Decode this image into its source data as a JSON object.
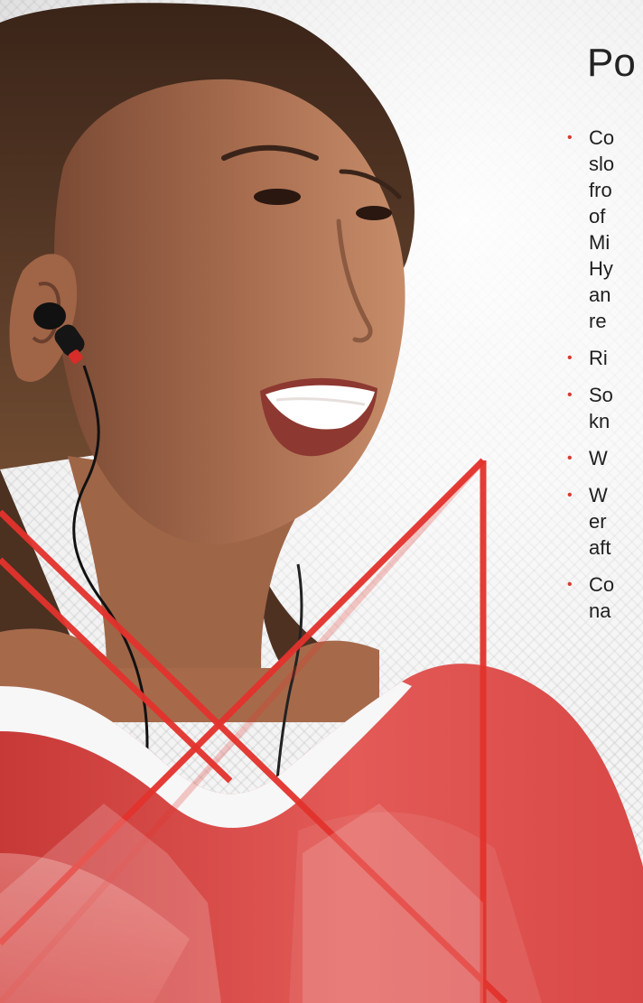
{
  "slide": {
    "title": "Po",
    "bullets": [
      {
        "lines": [
          "Co",
          "slo",
          "fro",
          "of",
          "Mi",
          "Hy",
          "an",
          "re"
        ]
      },
      {
        "lines": [
          "Ri"
        ]
      },
      {
        "lines": [
          "So",
          "kn"
        ]
      },
      {
        "lines": [
          "W"
        ]
      },
      {
        "lines": [
          "W",
          "er",
          "aft"
        ]
      },
      {
        "lines": [
          "Co",
          "na"
        ]
      }
    ]
  },
  "colors": {
    "accent_red": "#e02f2a",
    "shirt_red": "#e2504d",
    "text": "#1f1f1f"
  },
  "icons": {
    "bullet": "red-bullet-dot",
    "earbud": "earbud-icon"
  }
}
